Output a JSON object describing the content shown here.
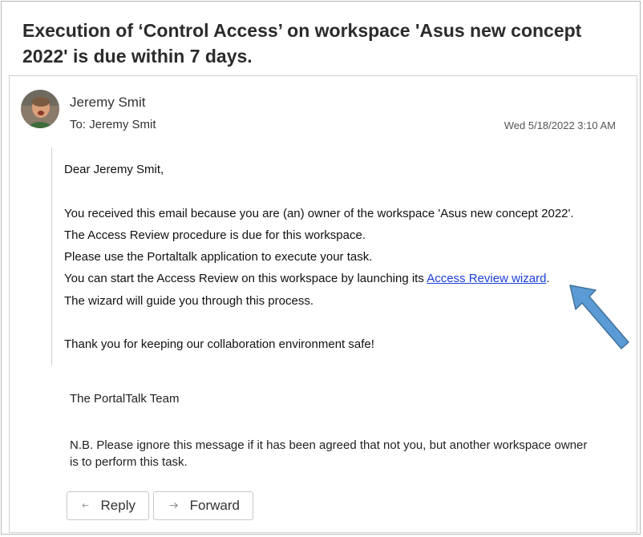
{
  "subject": "Execution of ‘Control Access’ on workspace 'Asus new concept 2022' is due within 7 days.",
  "sender": {
    "name": "Jeremy Smit",
    "avatar_icon": "person-avatar"
  },
  "recipient": {
    "label": "To:",
    "name": "Jeremy Smit"
  },
  "date": "Wed 5/18/2022 3:10 AM",
  "body": {
    "greeting": "Dear Jeremy Smit,",
    "line1": "You received this email because you are (an) owner of the workspace 'Asus new concept 2022'.",
    "line2": "The Access Review procedure is due for this workspace.",
    "line3": "Please use the Portaltalk application to execute your task.",
    "line4_prefix": "You can start the Access Review on this workspace by launching its ",
    "line4_link": "Access Review wizard",
    "line4_suffix": ".",
    "line5": "The wizard will guide you through this process.",
    "closing": "Thank you for keeping our collaboration environment safe!"
  },
  "signature": "The PortalTalk Team",
  "note": "N.B. Please ignore this message if it has been agreed that not you, but another workspace owner is to perform this task.",
  "actions": {
    "reply_label": "Reply",
    "forward_label": "Forward"
  },
  "colors": {
    "link": "#1a3fd6",
    "arrow_fill": "#5b9bd5",
    "arrow_stroke": "#41719c"
  }
}
